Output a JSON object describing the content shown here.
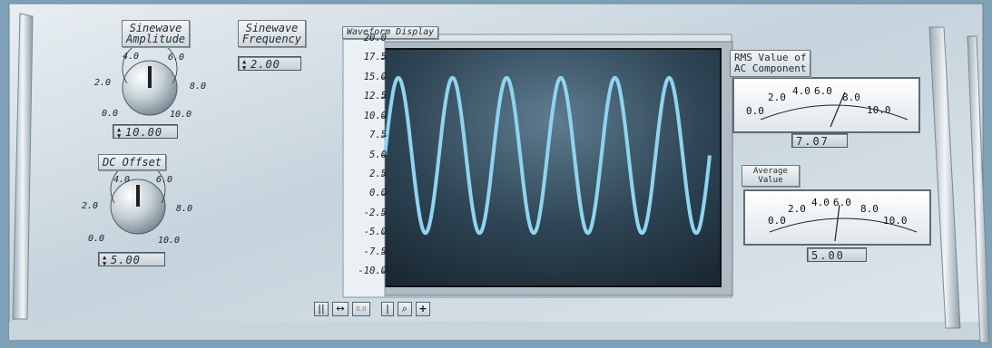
{
  "amplitude": {
    "title": "Sinewave\nAmplitude",
    "ticks": [
      "4.0",
      "6.0",
      "2.0",
      "8.0",
      "0.0",
      "10.0"
    ],
    "value": "10.00",
    "level": 5.0
  },
  "frequency": {
    "title": "Sinewave\nFrequency",
    "value": "2.00"
  },
  "offset": {
    "title": "DC Offset",
    "ticks": [
      "4.0",
      "6.0",
      "2.0",
      "8.0",
      "0.0",
      "10.0"
    ],
    "value": "5.00",
    "level": 5.0
  },
  "waveform": {
    "title": "Waveform Display",
    "y_ticks": [
      "20.0",
      "17.5",
      "15.0",
      "12.5",
      "10.0",
      "7.5",
      "5.0",
      "2.5",
      "0.0",
      "-2.5",
      "-5.0",
      "-7.5",
      "-10.0"
    ],
    "line_color": "#8fd4f0",
    "toolbar": [
      "||",
      "↔",
      "0.0",
      "|",
      "⌕",
      "+"
    ]
  },
  "rms_meter": {
    "title": "RMS Value of\nAC Component",
    "scale": [
      "0.0",
      "2.0",
      "4.0",
      "6.0",
      "8.0",
      "10.0"
    ],
    "value": "7.07",
    "reading": 7.07
  },
  "avg_meter": {
    "title": "Average\nValue",
    "scale": [
      "0.0",
      "2.0",
      "4.0",
      "6.0",
      "8.0",
      "10.0"
    ],
    "value": "5.00",
    "reading": 5.0
  },
  "chart_data": {
    "type": "line",
    "title": "Waveform Display",
    "xlabel": "",
    "ylabel": "",
    "ylim": [
      -10.0,
      20.0
    ],
    "cycles": 6,
    "amplitude": 10.0,
    "offset": 5.0,
    "series": [
      {
        "name": "",
        "values": [
          5,
          15,
          5,
          -5,
          5,
          15,
          5,
          -5,
          5,
          15,
          5,
          -5,
          5,
          15,
          5,
          -5,
          5,
          15,
          5,
          -5,
          5,
          15,
          5,
          -5,
          5
        ]
      }
    ]
  }
}
